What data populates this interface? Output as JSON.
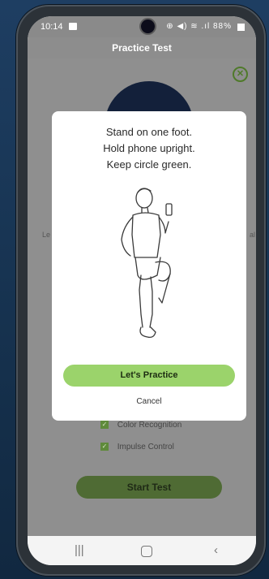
{
  "status_bar": {
    "time": "10:14",
    "icons_text": "⊕ ◀) ≋ .ıl",
    "battery": "88%"
  },
  "header": {
    "title": "Practice Test"
  },
  "background": {
    "left_edge_text": "Le",
    "right_edge_text": "al",
    "checklist": [
      {
        "label": "Color Recognition",
        "checked": true
      },
      {
        "label": "Impulse Control",
        "checked": true
      }
    ],
    "start_label": "Start Test"
  },
  "modal": {
    "instruction_lines": [
      "Stand on one foot.",
      "Hold phone upright.",
      "Keep circle green."
    ],
    "practice_label": "Let's Practice",
    "cancel_label": "Cancel"
  },
  "icons": {
    "close": "close-icon",
    "recents": "recents-icon",
    "home": "home-icon",
    "back": "back-icon"
  },
  "colors": {
    "accent_green": "#9bd36b",
    "dark_green": "#4f6b34",
    "background_navy": "#1e3e62"
  }
}
